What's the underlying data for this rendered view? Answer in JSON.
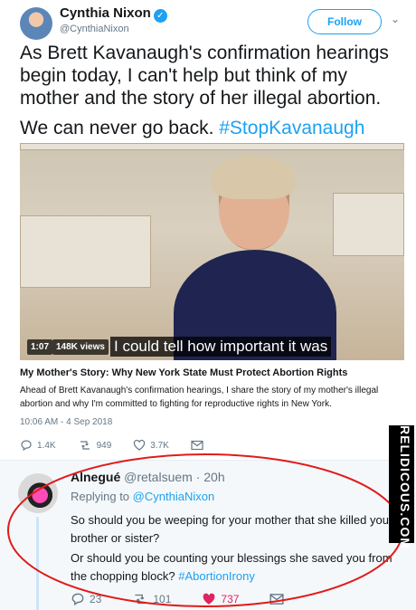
{
  "tweet": {
    "author_name": "Cynthia Nixon",
    "author_handle": "@CynthiaNixon",
    "follow_label": "Follow",
    "text_line1": "As Brett Kavanaugh's confirmation hearings begin today, I can't help but think of my mother and the story of her illegal abortion.",
    "text_line2_prefix": "We can never go back.",
    "hashtag": "#StopKavanaugh",
    "media": {
      "time": "1:07",
      "views": "148K views",
      "caption": "I could tell how important it was"
    },
    "card_title": "My Mother's Story: Why New York State Must Protect Abortion Rights",
    "card_description": "Ahead of Brett Kavanaugh's confirmation hearings, I share the story of my mother's illegal abortion and why I'm committed to fighting for reproductive rights in New York.",
    "timestamp": "10:06 AM - 4 Sep 2018",
    "replies": "1.4K",
    "retweets": "949",
    "likes": "3.7K"
  },
  "reply": {
    "author_name": "Alnegué",
    "author_handle": "@retalsuem",
    "time": "· 20h",
    "replying_prefix": "Replying to",
    "replying_to": "@CynthiaNixon",
    "text_line1": "So should you be weeping for your mother that she killed your brother or sister?",
    "text_line2": "Or should you be counting your blessings she saved you from the chopping block?",
    "hashtag": "#AbortionIrony",
    "replies": "23",
    "retweets": "101",
    "likes": "737"
  },
  "watermark": "RELIDICOUS.COM",
  "colors": {
    "accent": "#1da1f2",
    "like": "#e0245e",
    "annotation_circle": "#e01b1b"
  },
  "icons": [
    "verified-icon",
    "chevron-down-icon",
    "reply-icon",
    "retweet-icon",
    "like-icon",
    "message-icon"
  ]
}
